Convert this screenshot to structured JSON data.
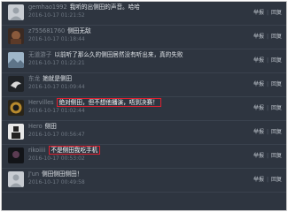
{
  "actions": {
    "report": "举报",
    "reply": "回复",
    "separator": "|"
  },
  "comments": [
    {
      "user": "gemhao1992",
      "text": "我听的出侧田的声音。哈哈",
      "time": "2016-10-17 01:21:52",
      "highlight": false,
      "avatar": "avatar-generic"
    },
    {
      "user": "z755681760",
      "text": "侧田无敌",
      "time": "2016-10-17 01:18:44",
      "highlight": false,
      "avatar": "avatar-photo"
    },
    {
      "user": "无道游子",
      "text": "以前听了那么久的侧田居然没有听出来，真的失败",
      "time": "2016-10-17 01:22:21",
      "highlight": false,
      "avatar": "avatar-landscape"
    },
    {
      "user": "东龙",
      "text": "她就是侧田",
      "time": "2016-10-17 01:09:44",
      "highlight": false,
      "avatar": "avatar-bird"
    },
    {
      "user": "Hervilles",
      "text": "绝对侧田，但不想他播演，唔到决赛！",
      "time": "2016-10-17 01:02:44",
      "highlight": true,
      "avatar": "avatar-emblem"
    },
    {
      "user": "Hero",
      "text": "侧田",
      "time": "2016-10-17 00:56:47",
      "highlight": false,
      "avatar": "avatar-figure"
    },
    {
      "user": "rikoiiii",
      "text": "不是侧田我吃手机",
      "time": "2016-10-17 00:53:02",
      "highlight": true,
      "avatar": "avatar-dark"
    },
    {
      "user": "J'un",
      "text": "侧田侧田侧田！",
      "time": "2016-10-17 00:49:58",
      "highlight": false,
      "avatar": "avatar-generic"
    }
  ]
}
